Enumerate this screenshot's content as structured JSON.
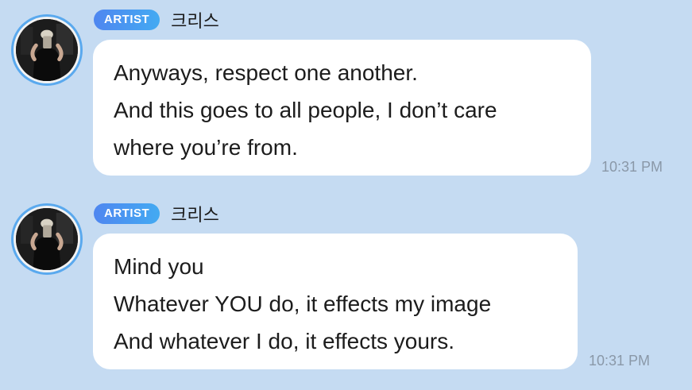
{
  "messages": [
    {
      "badge": "ARTIST",
      "sender": "크리스",
      "lines": [
        "Anyways, respect one another.",
        "And this goes to all people, I don’t care",
        "where you’re from."
      ],
      "time": "10:31 PM"
    },
    {
      "badge": "ARTIST",
      "sender": "크리스",
      "lines": [
        "Mind you",
        "Whatever YOU do, it effects my image",
        "And whatever I do, it effects yours."
      ],
      "time": "10:31 PM"
    }
  ],
  "colors": {
    "background": "#c5dbf2",
    "badge": "#4f86f0",
    "avatar_ring": "#5aa9ee",
    "bubble": "#ffffff",
    "time": "#8a98a8"
  }
}
